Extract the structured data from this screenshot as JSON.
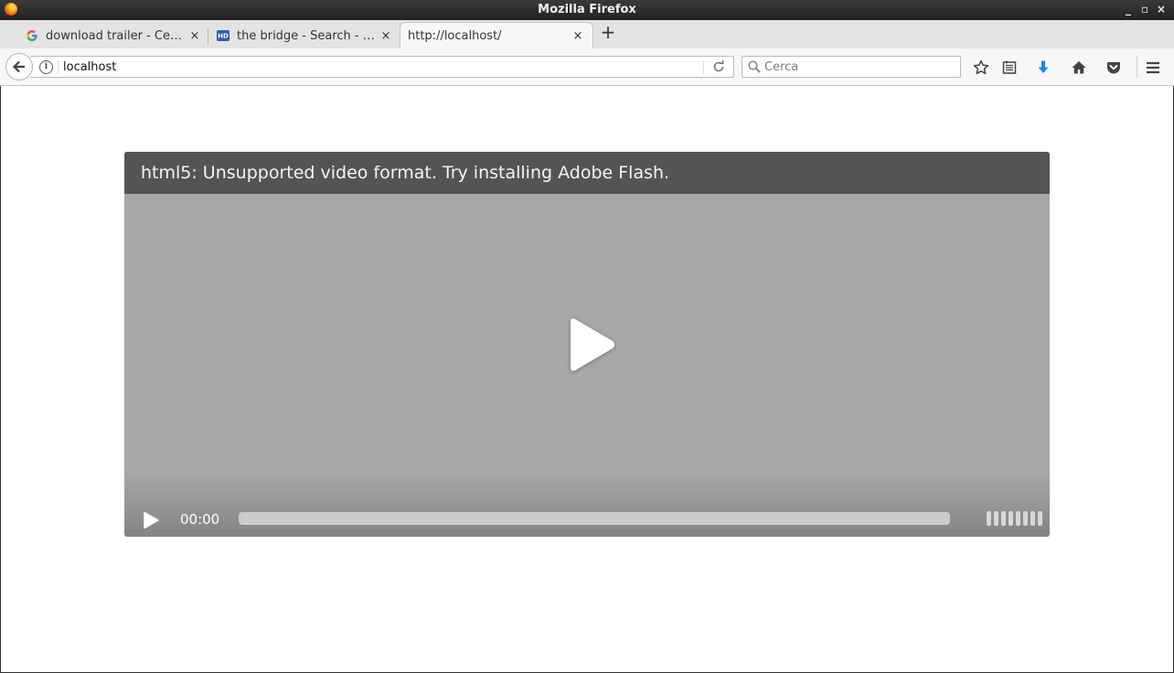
{
  "window": {
    "title": "Mozilla Firefox",
    "controls": [
      "_",
      "▫",
      "×"
    ]
  },
  "tabs": [
    {
      "label": "download trailer - Ce…",
      "favicon": "google-icon",
      "active": false
    },
    {
      "label": "the bridge - Search - …",
      "favicon": "hd-site-icon",
      "active": false
    },
    {
      "label": "http://localhost/",
      "favicon": "",
      "active": true
    }
  ],
  "tab_close_glyph": "×",
  "new_tab_glyph": "+",
  "navbar": {
    "url": "localhost",
    "search_placeholder": "Cerca"
  },
  "player": {
    "message": "html5: Unsupported video format. Try installing Adobe Flash.",
    "time": "00:00",
    "progress": 0,
    "volume_level": 1.0
  },
  "colors": {
    "player_bg": "#a8a8a8",
    "message_bar": "#545454",
    "download_arrow": "#1a84e8"
  }
}
